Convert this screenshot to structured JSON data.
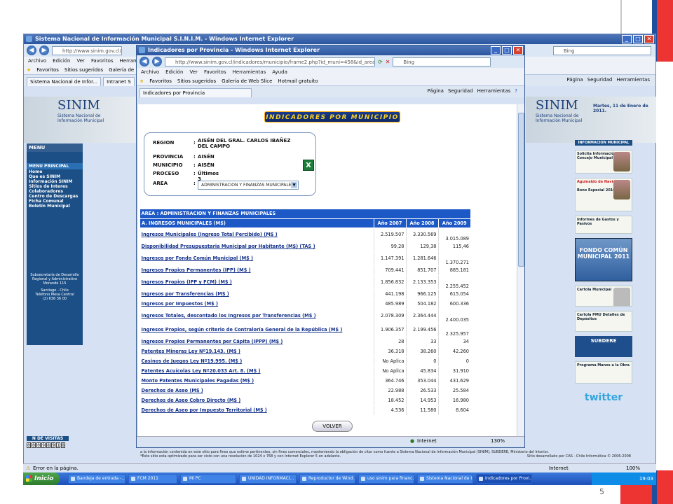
{
  "slide_number": "5",
  "outer_window": {
    "title": "Sistema Nacional de Información Municipal S.I.N.I.M. - Windows Internet Explorer",
    "address": "http://www.sinim.gov.cl/",
    "menu": [
      "Archivo",
      "Edición",
      "Ver",
      "Favoritos",
      "Herramientas"
    ],
    "favorites_label": "Favoritos",
    "fav_items": [
      "Sitios sugeridos",
      "Galería de"
    ],
    "tabs": [
      "Sistema Nacional de Infor...",
      "Intranet S"
    ],
    "search_placeholder": "Bing",
    "right_tools": [
      "Página",
      "Seguridad",
      "Herramientas"
    ],
    "status": "Error en la página.",
    "status_zone": "Internet",
    "zoom": "100%",
    "date_text": "Martes, 11 de Enero de 2011."
  },
  "site": {
    "logo": "SINIM",
    "logo_sub": "Sistema Nacional de Información Municipal",
    "menu_title": "MENU",
    "menu_head": "MENU PRINCIPAL",
    "menu_items": [
      "Home",
      "Que es SINIM",
      "Información SINIM",
      "Sitios de Interes",
      "Colaboradores",
      "Centro de Descargas",
      "Ficha Comunal",
      "Boletín Municipal"
    ],
    "address_block": [
      "Subsecretaría de Desarrollo",
      "Regional y Administrativo",
      "Morandé 115",
      "",
      "Santiago - Chile",
      "Teléfono Mesa Central",
      "(2) 636 36 00"
    ],
    "visitas_label": "N DE VISITAS",
    "visitas_digits": [
      "0",
      "0",
      "0",
      "9",
      "8",
      "9",
      "1",
      "8"
    ],
    "right_head": "INFORMACION MUNICIPAL",
    "right_items": [
      "Solicita Información Concejo Municipal",
      "Aguinaldo de Navidad",
      "Bono Especial 2010",
      "Informes de Gastos y Pasivos",
      "FONDO COMÚN MUNICIPAL 2011",
      "Cartola Municipal",
      "Cartola PMU Detalles de Depósitos",
      "SUBDERE",
      "Programa Manos a la Obra"
    ],
    "twitter": "twitter",
    "footer_line1": "a la información contenida en este sitio para fines que estime pertinentes, sin fines comerciales, manteniendo la obligación de citar como fuente a Sistema Nacional de Información Municipal (SINIM), SUBDERE, Ministerio del Interior.",
    "footer_line2": "*Este sitio esta optimizado para ser visto con una resolución de 1024 x 768 y con Internet Explorer 5 en adelante.",
    "footer_right": "Sitio desarrollado por CAS - Chile Informática © 2006-2008"
  },
  "popup": {
    "title": "Indicadores por Provincia - Windows Internet Explorer",
    "address": "http://www.sinim.gov.cl/indicadores/municipio/frame2.php?id_muni=458&id_area=1&id_subarea=nobsel...",
    "search": "Bing",
    "menu": [
      "Archivo",
      "Edición",
      "Ver",
      "Favoritos",
      "Herramientas",
      "Ayuda"
    ],
    "favorites_label": "Favoritos",
    "fav_items": [
      "Sitios sugeridos",
      "Galería de Web Slice",
      "Hotmail gratuito"
    ],
    "tab": "Indicadores por Provincia",
    "tools": [
      "Página",
      "Seguridad",
      "Herramientas"
    ],
    "banner": "INDICADORES POR MUNICIPIO",
    "info": [
      {
        "label": "REGION",
        "value": "AISÉN DEL GRAL. CARLOS IBAÑEZ DEL CAMPO"
      },
      {
        "label": "PROVINCIA",
        "value": "AISÉN"
      },
      {
        "label": "MUNICIPIO",
        "value": "AISÉN"
      },
      {
        "label": "PROCESO",
        "value": "Últimos 3 Procesos"
      }
    ],
    "area_label": "AREA",
    "area_select": "ADMINISTRACION Y FINANZAS MUNICIPALES",
    "table_area": "AREA : ADMINISTRACION Y FINANZAS MUNICIPALES",
    "table_header": [
      "A. INGRESOS MUNICIPALES (M$)",
      "Año 2007",
      "Año 2008",
      "Año 2009"
    ],
    "rows": [
      [
        "Ingresos Municipales (Ingreso Total Percibido) (M$ )",
        "2.519.507",
        "3.330.569",
        "3.015.089"
      ],
      [
        "Disponibilidad Presupuestaria Municipal por Habitante (M$) (TAS )",
        "99,28",
        "129,38",
        "115,46"
      ],
      [
        "Ingresos por Fondo Común Municipal (M$ )",
        "1.147.391",
        "1.281.646",
        "1.370.271"
      ],
      [
        "Ingresos Propios Permanentes (IPP) (M$ )",
        "709.441",
        "851.707",
        "885.181"
      ],
      [
        "Ingresos Propios (IPP y FCM) (M$ )",
        "1.856.832",
        "2.133.353",
        "2.255.452"
      ],
      [
        "Ingresos por Transferencias (M$ )",
        "441.198",
        "966.125",
        "615.054"
      ],
      [
        "Ingresos por Impuestos (M$ )",
        "485.989",
        "504.182",
        "600.336"
      ],
      [
        "Ingresos Totales, descontado los Ingresos por Transferencias (M$ )",
        "2.078.309",
        "2.364.444",
        "2.400.035"
      ],
      [
        "Ingresos Propios, según criterio de Contraloría General de la República (M$ )",
        "1.906.357",
        "2.199.456",
        "2.325.957"
      ],
      [
        "Ingresos Propios Permanentes per Cápita (IPPP) (M$ )",
        "28",
        "33",
        "34"
      ],
      [
        "Patentes Mineras Ley Nº19.143. (M$ )",
        "36.318",
        "38.260",
        "42.260"
      ],
      [
        "Casinos de Juegos Ley Nº19.995. (M$ )",
        "No Aplica",
        "0",
        "0"
      ],
      [
        "Patentes Acuícolas Ley Nº20.033 Art. 8. (M$ )",
        "No Aplica",
        "45.834",
        "31.910"
      ],
      [
        "Monto Patentes Municipales Pagadas (M$ )",
        "364.746",
        "353.044",
        "431.629"
      ],
      [
        "Derechos de Aseo (M$ )",
        "22.988",
        "26.533",
        "25.584"
      ],
      [
        "Derechos de Aseo Cobro Directo (M$ )",
        "18.452",
        "14.953",
        "16.980"
      ],
      [
        "Derechos de Aseo por Impuesto Territorial (M$ )",
        "4.536",
        "11.580",
        "8.604"
      ]
    ],
    "volver": "VOLVER",
    "status_zone": "Internet",
    "zoom": "130%"
  },
  "taskbar": {
    "start": "Inicio",
    "items": [
      "Bandeja de entrada -...",
      "FCM 2011",
      "Mi PC",
      "UNIDAD INFORMACI...",
      "Reproductor de Wind...",
      "uso sinim para financ...",
      "Sistema Nacional de I...",
      "Indicadores por Provi..."
    ],
    "clock": "19:03"
  }
}
